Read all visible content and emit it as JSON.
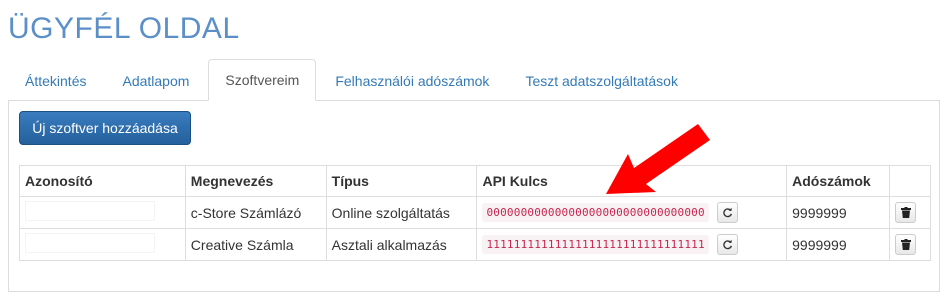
{
  "page": {
    "title": "ÜGYFÉL OLDAL"
  },
  "tabs": [
    {
      "label": "Áttekintés",
      "active": false
    },
    {
      "label": "Adatlapom",
      "active": false
    },
    {
      "label": "Szoftvereim",
      "active": true
    },
    {
      "label": "Felhasználói adószámok",
      "active": false
    },
    {
      "label": "Teszt adatszolgáltatások",
      "active": false
    }
  ],
  "toolbar": {
    "add_label": "Új szoftver hozzáadása"
  },
  "table": {
    "headers": [
      "Azonosító",
      "Megnevezés",
      "Típus",
      "API Kulcs",
      "Adószámok",
      ""
    ],
    "rows": [
      {
        "id": "",
        "name": "c-Store Számlázó",
        "type": "Online szolgáltatás",
        "api_key": "00000000000000000000000000000000",
        "tax_ids": "9999999"
      },
      {
        "id": "",
        "name": "Creative Számla",
        "type": "Asztali alkalmazás",
        "api_key": "11111111111111111111111111111111",
        "tax_ids": "9999999"
      }
    ]
  },
  "icons": {
    "refresh": "refresh-icon",
    "trash": "trash-icon",
    "annotation": "red-arrow-annotation"
  },
  "colors": {
    "title": "#5b8fc7",
    "link": "#337ab7",
    "primary_button": "#2a6aa8",
    "code_text": "#c7254e",
    "code_bg": "#f9f2f4",
    "arrow": "#ff0000"
  }
}
